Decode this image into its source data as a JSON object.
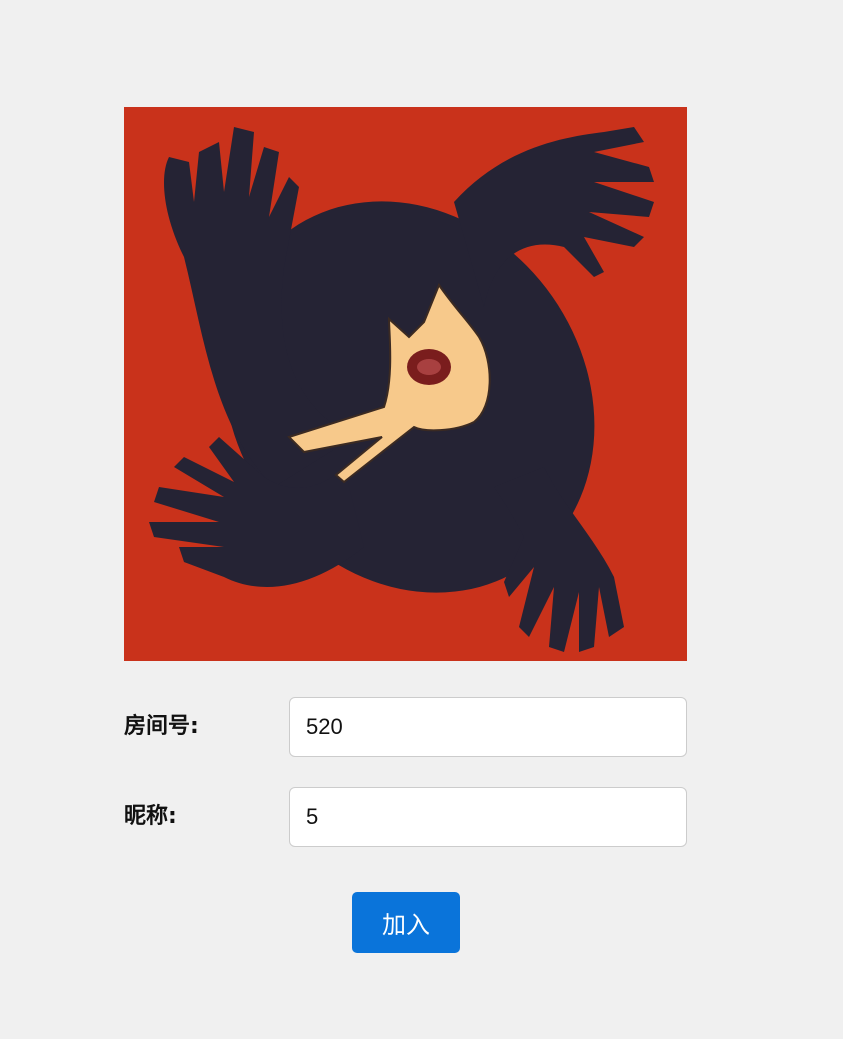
{
  "logo": {
    "icon": "werewolf-logo-icon",
    "background_color": "#c9321b",
    "shadow_color": "#252334",
    "wolf_head_color": "#f7c98b",
    "eye_color": "#7a1d1d"
  },
  "form": {
    "room_label": "房间号:",
    "room_value": "520",
    "nickname_label": "昵称:",
    "nickname_value": "5"
  },
  "actions": {
    "join_label": "加入",
    "join_color": "#0a74da"
  }
}
